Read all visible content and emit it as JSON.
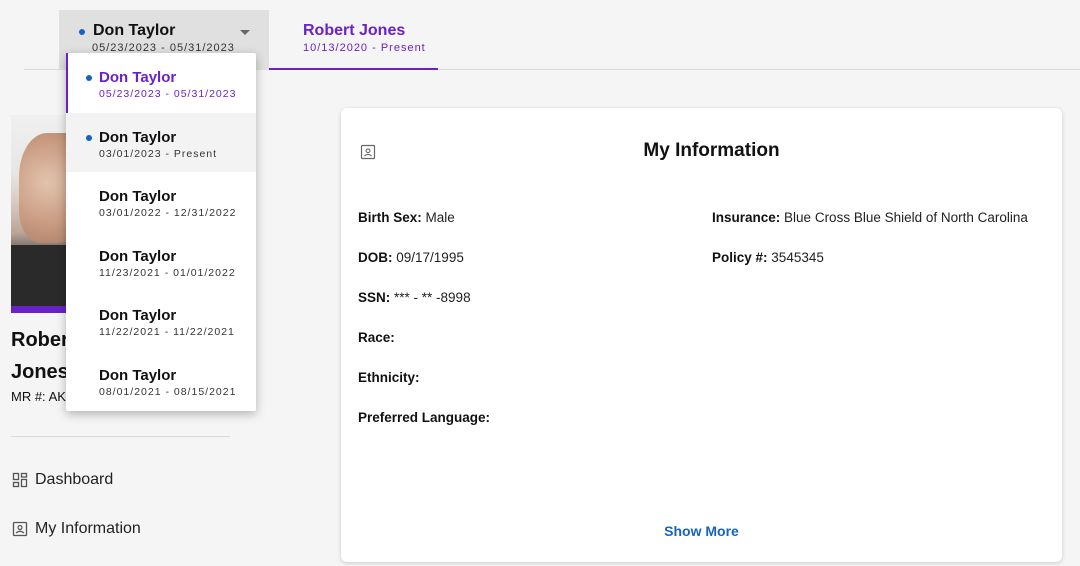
{
  "tabs": {
    "active_patient": {
      "name": "Don Taylor",
      "dates": "05/23/2023 - 05/31/2023"
    },
    "second_patient": {
      "name": "Robert Jones",
      "dates": "10/13/2020 - Present"
    }
  },
  "dropdown": {
    "items": [
      {
        "name": "Don Taylor",
        "dates": "05/23/2023 - 05/31/2023"
      },
      {
        "name": "Don Taylor",
        "dates": "03/01/2023 - Present"
      },
      {
        "name": "Don Taylor",
        "dates": "03/01/2022 - 12/31/2022"
      },
      {
        "name": "Don Taylor",
        "dates": "11/23/2021 - 01/01/2022"
      },
      {
        "name": "Don Taylor",
        "dates": "11/22/2021 - 11/22/2021"
      },
      {
        "name": "Don Taylor",
        "dates": "08/01/2021 - 08/15/2021"
      }
    ]
  },
  "sidebar": {
    "name_line1": "Rober",
    "name_line2": "Jones",
    "mr_label": "MR #: AK",
    "nav": {
      "dashboard": "Dashboard",
      "my_information": "My Information"
    }
  },
  "card": {
    "title": "My Information",
    "fields": {
      "birth_sex_label": "Birth Sex:",
      "birth_sex_value": "Male",
      "dob_label": "DOB:",
      "dob_value": "09/17/1995",
      "ssn_label": "SSN:",
      "ssn_value": "*** - ** -8998",
      "race_label": "Race:",
      "race_value": "",
      "ethnicity_label": "Ethnicity:",
      "ethnicity_value": "",
      "language_label": "Preferred Language:",
      "language_value": "",
      "insurance_label": "Insurance:",
      "insurance_value": "Blue Cross Blue Shield of North Carolina",
      "policy_label": "Policy #:",
      "policy_value": "3545345"
    },
    "show_more": "Show More"
  },
  "colors": {
    "accent": "#6b21c8",
    "link": "#1565c0",
    "dot": "#1565c0"
  }
}
